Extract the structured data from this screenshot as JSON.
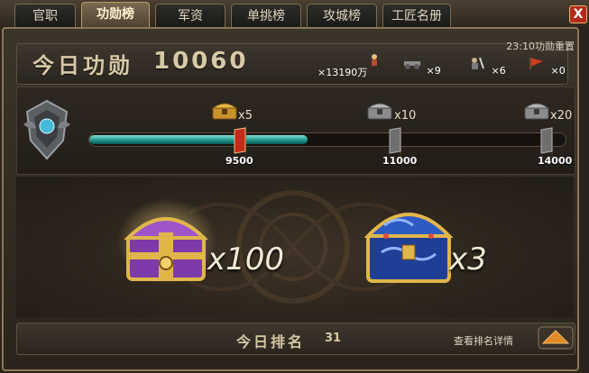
{
  "tabs": [
    {
      "label": "官职"
    },
    {
      "label": "功勋榜"
    },
    {
      "label": "军资"
    },
    {
      "label": "单挑榜"
    },
    {
      "label": "攻城榜"
    },
    {
      "label": "工匠名册"
    }
  ],
  "active_tab": "功勋榜",
  "close_label": "X",
  "header": {
    "merit_label": "今日功勋",
    "merit_value": "10060",
    "reset_time": "23:10功勋重置"
  },
  "resources": [
    {
      "icon": "silver-icon",
      "count": "×13190万"
    },
    {
      "icon": "cannon-icon",
      "count": "×9"
    },
    {
      "icon": "soldier-icon",
      "count": "×6"
    },
    {
      "icon": "banner-icon",
      "count": "×0"
    }
  ],
  "progress": {
    "current": 10060,
    "max": 14000,
    "milestones": [
      {
        "value": "9500",
        "chest_mult": "x5",
        "chest": "gold-chest-icon"
      },
      {
        "value": "11000",
        "chest_mult": "x10",
        "chest": "silver-chest-icon"
      },
      {
        "value": "14000",
        "chest_mult": "x20",
        "chest": "silver-chest-icon"
      }
    ]
  },
  "rewards": [
    {
      "icon": "purple-treasure-chest-icon",
      "mult": "x100"
    },
    {
      "icon": "blue-treasure-chest-icon",
      "mult": "x3"
    }
  ],
  "footer": {
    "rank_label": "今日排名",
    "rank_value": "31",
    "details_label": "查看排名详情"
  },
  "colors": {
    "progress_fill": "#1d8e86",
    "text_gold": "#d8c9a6",
    "panel_bg": "#2a241c"
  }
}
